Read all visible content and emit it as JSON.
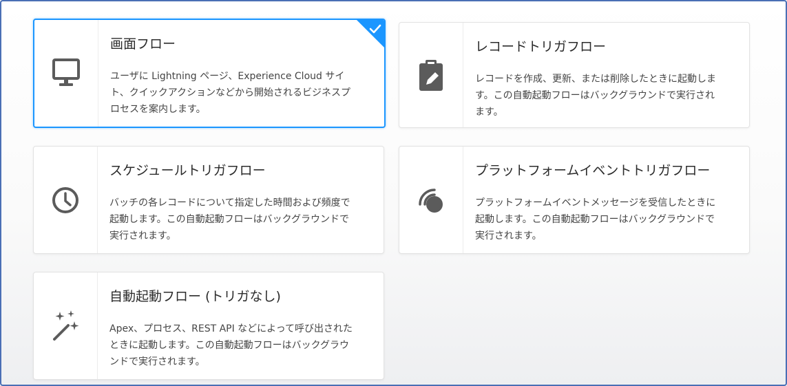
{
  "cards": [
    {
      "key": "screen-flow",
      "title": "画面フロー",
      "description": "ユーザに Lightning ページ、Experience Cloud サイト、クイックアクションなどから開始されるビジネスプロセスを案内します。",
      "icon": "monitor-icon",
      "selected": true
    },
    {
      "key": "record-triggered-flow",
      "title": "レコードトリガフロー",
      "description": "レコードを作成、更新、または削除したときに起動します。この自動起動フローはバックグラウンドで実行されます。",
      "icon": "clipboard-edit-icon",
      "selected": false
    },
    {
      "key": "schedule-triggered-flow",
      "title": "スケジュールトリガフロー",
      "description": "バッチの各レコードについて指定した時間および頻度で起動します。この自動起動フローはバックグラウンドで実行されます。",
      "icon": "clock-icon",
      "selected": false
    },
    {
      "key": "platform-event-triggered-flow",
      "title": "プラットフォームイベントトリガフロー",
      "description": "プラットフォームイベントメッセージを受信したときに起動します。この自動起動フローはバックグラウンドで実行されます。",
      "icon": "signal-icon",
      "selected": false
    },
    {
      "key": "autolaunched-flow",
      "title": "自動起動フロー (トリガなし)",
      "description": "Apex、プロセス、REST API などによって呼び出されたときに起動します。この自動起動フローはバックグラウンドで実行されます。",
      "icon": "magic-wand-icon",
      "selected": false
    }
  ],
  "colors": {
    "selected_border": "#1b96ff",
    "icon_gray": "#5b5b5b",
    "frame_border": "#4a6fb5"
  }
}
